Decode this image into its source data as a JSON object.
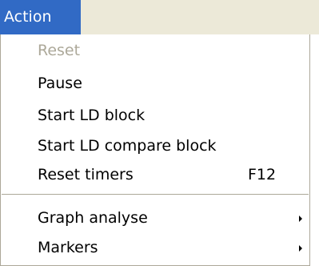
{
  "menubar": {
    "title": "Action"
  },
  "menu": {
    "reset": "Reset",
    "pause": "Pause",
    "start_ld_block": "Start LD block",
    "start_ld_compare_block": "Start LD compare block",
    "reset_timers": "Reset timers",
    "reset_timers_shortcut": "F12",
    "graph_analyse": "Graph analyse",
    "markers": "Markers"
  },
  "colors": {
    "menubar_background": "#ece9d8",
    "highlight": "#316ac5",
    "disabled_text": "#aca899",
    "menu_background": "#ffffff"
  },
  "icons": {
    "submenu_arrow": "submenu-arrow-icon"
  }
}
